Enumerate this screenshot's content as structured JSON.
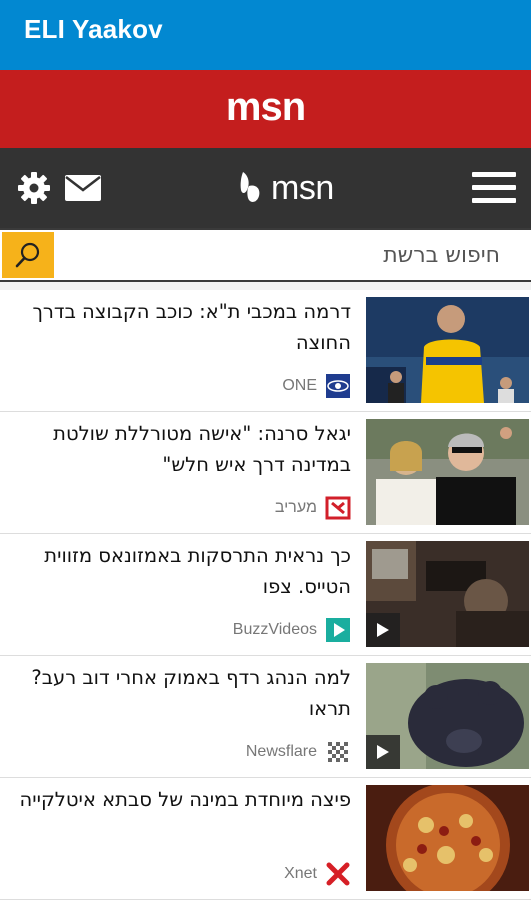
{
  "app_bar": {
    "title": "ELI Yaakov"
  },
  "banner": {
    "logo_text": "msn"
  },
  "navbar": {
    "brand_text": "msn",
    "icons": [
      "gear-icon",
      "mail-icon",
      "msn-butterfly-icon",
      "hamburger-menu-icon"
    ]
  },
  "search": {
    "placeholder": "חיפוש ברשת",
    "button_icon": "search-icon"
  },
  "colors": {
    "app_bar": "#0288d1",
    "banner": "#c41e1e",
    "navbar": "#333333",
    "search_button": "#f6b21a"
  },
  "articles": [
    {
      "headline": "דרמה במכבי ת\"א: כוכב הקבוצה בדרך החוצה",
      "source": "ONE",
      "source_icon": "one-logo-icon",
      "video": false
    },
    {
      "headline": "יגאל סרנה: \"אישה מטורללת שולטת במדינה דרך איש חלש\"",
      "source": "מעריב",
      "source_icon": "maariv-logo-icon",
      "video": false
    },
    {
      "headline": "כך נראית התרסקות באמזונאס מזווית הטייס. צפו",
      "source": "BuzzVideos",
      "source_icon": "buzzvideos-play-icon",
      "video": true
    },
    {
      "headline": "למה הנהג רדף באמוק אחרי דוב רעב? תראו",
      "source": "Newsflare",
      "source_icon": "newsflare-logo-icon",
      "video": true
    },
    {
      "headline": "פיצה מיוחדת במינה של סבתא איטלקייה",
      "source": "Xnet",
      "source_icon": "xnet-logo-icon",
      "video": false
    }
  ]
}
